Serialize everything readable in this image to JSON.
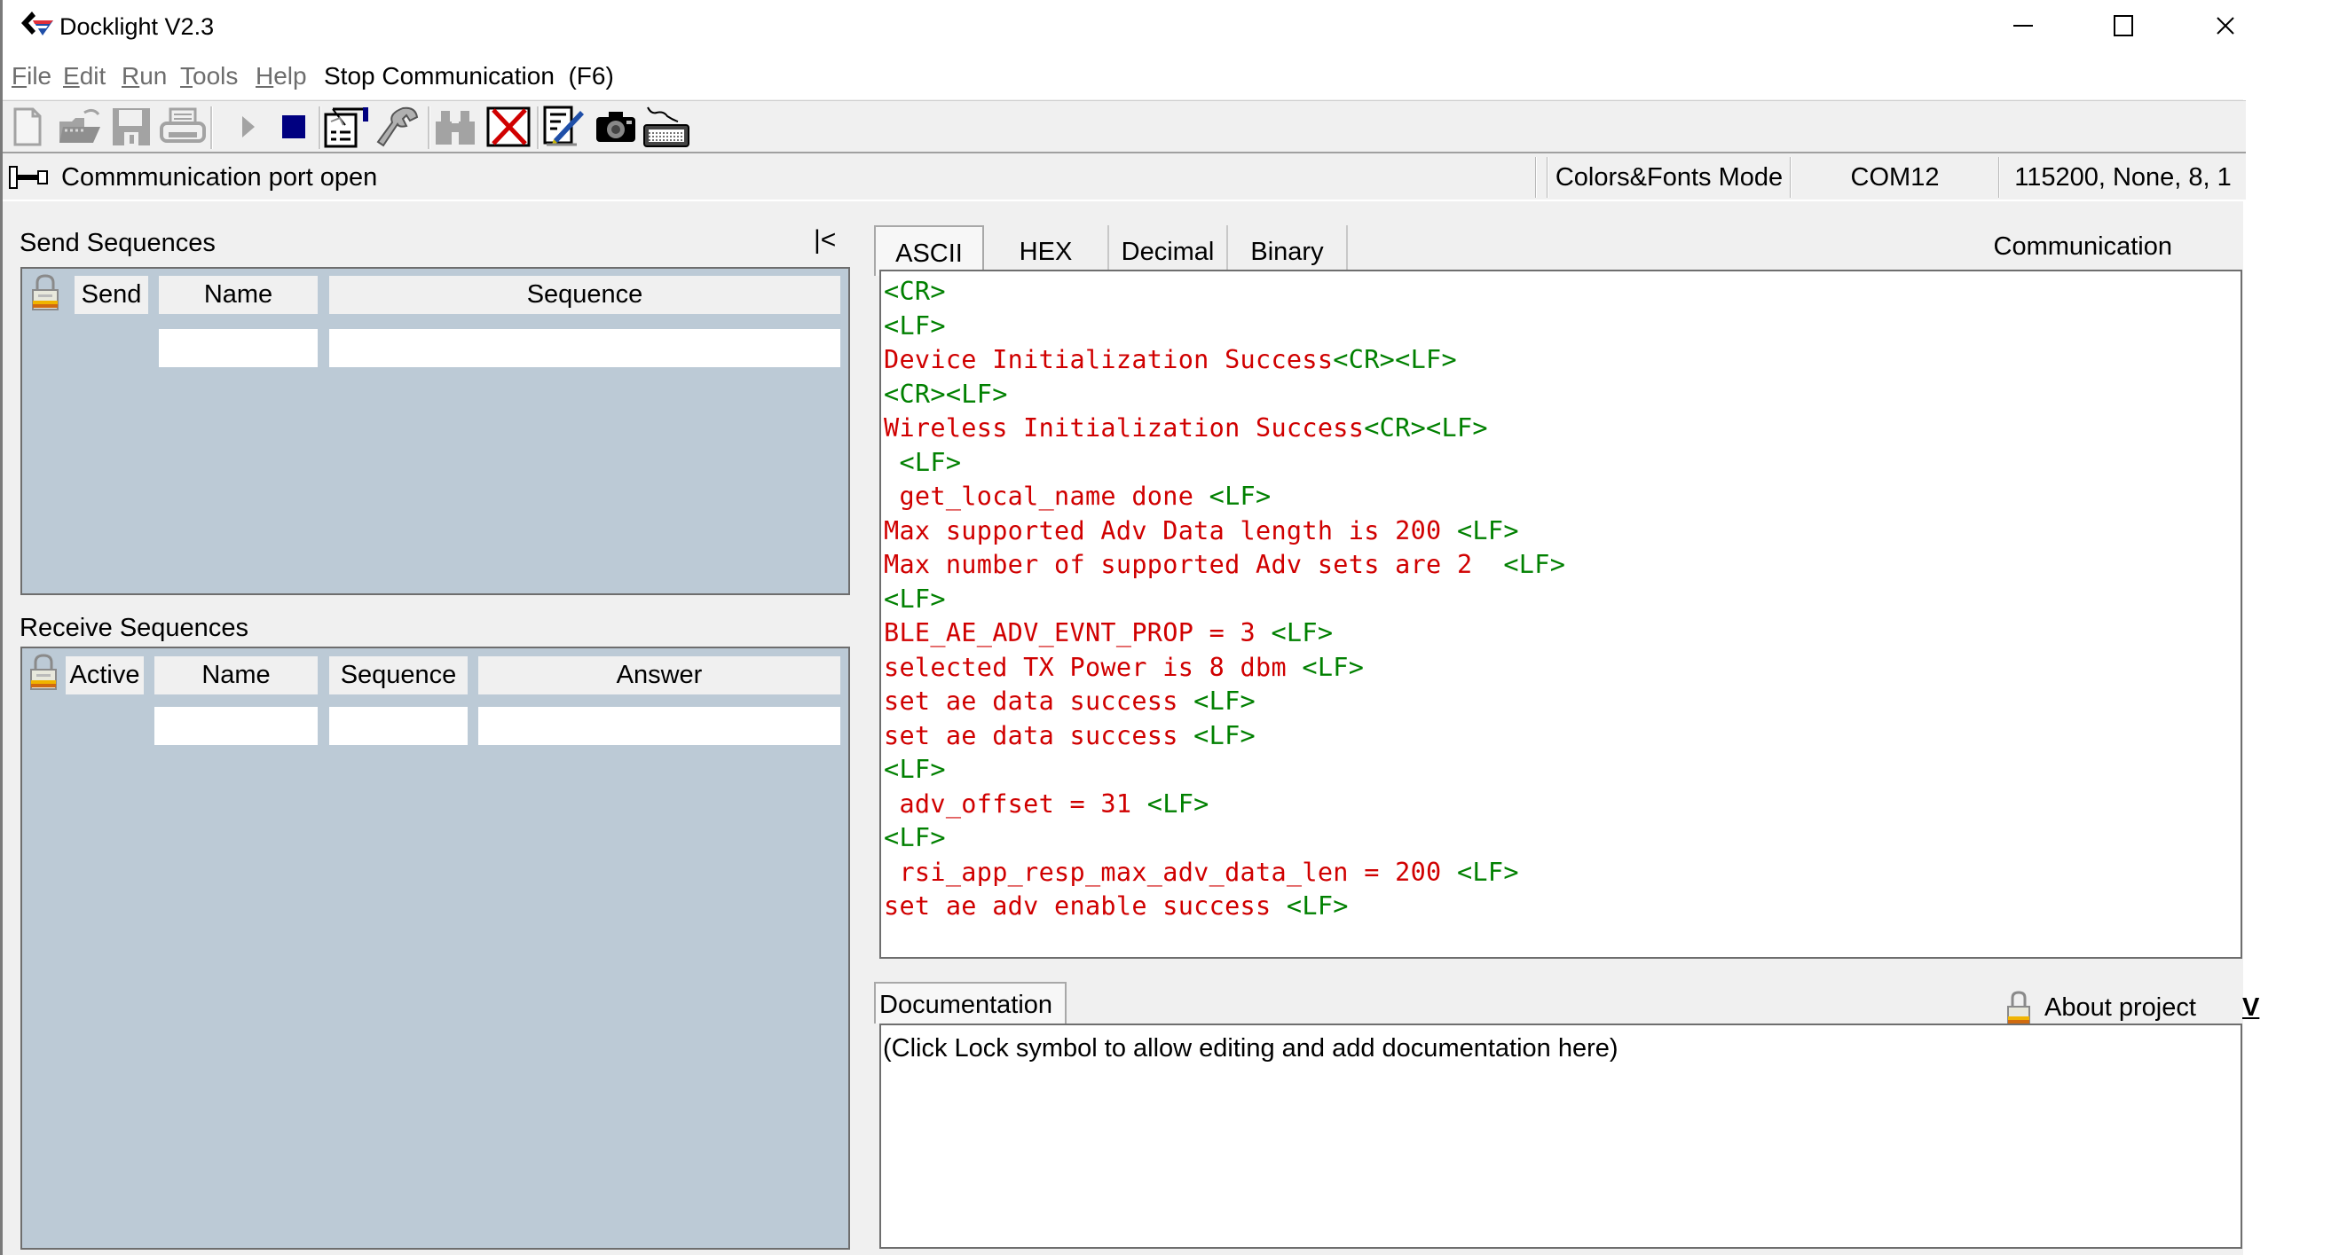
{
  "window": {
    "title": "Docklight V2.3",
    "controls": {
      "minimize": "–",
      "maximize": "☐",
      "close": "✕"
    }
  },
  "menu": {
    "items": [
      {
        "label": "File",
        "accel": "F",
        "rest": "ile",
        "enabled": false
      },
      {
        "label": "Edit",
        "accel": "E",
        "rest": "dit",
        "enabled": false
      },
      {
        "label": "Run",
        "accel": "R",
        "rest": "un",
        "enabled": false
      },
      {
        "label": "Tools",
        "accel": "T",
        "rest": "ools",
        "enabled": false
      },
      {
        "label": "Help",
        "accel": "H",
        "rest": "elp",
        "enabled": false
      }
    ],
    "action": "Stop Communication  (F6)"
  },
  "toolbar": {
    "buttons": [
      {
        "icon": "new-file-icon",
        "enabled": false
      },
      {
        "icon": "open-folder-icon",
        "enabled": false
      },
      {
        "icon": "save-icon",
        "enabled": false
      },
      {
        "icon": "print-icon",
        "enabled": false
      },
      {
        "icon": "run-icon",
        "enabled": false
      },
      {
        "icon": "stop-icon",
        "enabled": true,
        "color": "#000080"
      },
      {
        "icon": "project-settings-icon",
        "enabled": true
      },
      {
        "icon": "wrench-icon",
        "enabled": true
      },
      {
        "icon": "binoculars-icon",
        "enabled": false
      },
      {
        "icon": "clear-window-icon",
        "enabled": true
      },
      {
        "icon": "edit-note-icon",
        "enabled": true
      },
      {
        "icon": "snapshot-camera-icon",
        "enabled": true
      },
      {
        "icon": "keyboard-icon",
        "enabled": true
      }
    ]
  },
  "status": {
    "port_message": "Commmunication port open",
    "mode": "Colors&Fonts Mode",
    "port": "COM12",
    "settings": "115200, None, 8, 1"
  },
  "send_sequences": {
    "title": "Send Sequences",
    "collapse_label": "|<",
    "columns": [
      "Send",
      "Name",
      "Sequence"
    ],
    "rows": [
      {
        "name": "",
        "sequence": ""
      }
    ]
  },
  "receive_sequences": {
    "title": "Receive Sequences",
    "columns": [
      "Active",
      "Name",
      "Sequence",
      "Answer"
    ],
    "rows": [
      {
        "name": "",
        "sequence": "",
        "answer": ""
      }
    ]
  },
  "communication": {
    "label": "Communication",
    "tabs": [
      {
        "label": "ASCII",
        "selected": true
      },
      {
        "label": "HEX",
        "selected": false
      },
      {
        "label": "Decimal",
        "selected": false
      },
      {
        "label": "Binary",
        "selected": false
      }
    ],
    "colors": {
      "text": "#d00000",
      "control": "#008000"
    },
    "lines": [
      [
        [
          "c",
          "<CR>"
        ]
      ],
      [
        [
          "c",
          "<LF>"
        ]
      ],
      [
        [
          "t",
          "Device Initialization Success"
        ],
        [
          "c",
          "<CR><LF>"
        ]
      ],
      [
        [
          "c",
          "<CR><LF>"
        ]
      ],
      [
        [
          "t",
          "Wireless Initialization Success"
        ],
        [
          "c",
          "<CR><LF>"
        ]
      ],
      [
        [
          "t",
          " "
        ],
        [
          "c",
          "<LF>"
        ]
      ],
      [
        [
          "t",
          " get_local_name done "
        ],
        [
          "c",
          "<LF>"
        ]
      ],
      [
        [
          "t",
          "Max supported Adv Data length is 200 "
        ],
        [
          "c",
          "<LF>"
        ]
      ],
      [
        [
          "t",
          "Max number of supported Adv sets are 2  "
        ],
        [
          "c",
          "<LF>"
        ]
      ],
      [
        [
          "c",
          "<LF>"
        ]
      ],
      [
        [
          "t",
          "BLE_AE_ADV_EVNT_PROP = 3 "
        ],
        [
          "c",
          "<LF>"
        ]
      ],
      [
        [
          "t",
          "selected TX Power is 8 dbm "
        ],
        [
          "c",
          "<LF>"
        ]
      ],
      [
        [
          "t",
          "set ae data success "
        ],
        [
          "c",
          "<LF>"
        ]
      ],
      [
        [
          "t",
          "set ae data success "
        ],
        [
          "c",
          "<LF>"
        ]
      ],
      [
        [
          "c",
          "<LF>"
        ]
      ],
      [
        [
          "t",
          " adv_offset = 31 "
        ],
        [
          "c",
          "<LF>"
        ]
      ],
      [
        [
          "c",
          "<LF>"
        ]
      ],
      [
        [
          "t",
          " rsi_app_resp_max_adv_data_len = 200 "
        ],
        [
          "c",
          "<LF>"
        ]
      ],
      [
        [
          "t",
          "set ae adv enable success "
        ],
        [
          "c",
          "<LF>"
        ]
      ]
    ]
  },
  "documentation": {
    "tab_label": "Documentation",
    "about_label": "About project",
    "toggle_label": "V",
    "placeholder_text": "(Click Lock symbol to allow editing and add documentation here)"
  }
}
